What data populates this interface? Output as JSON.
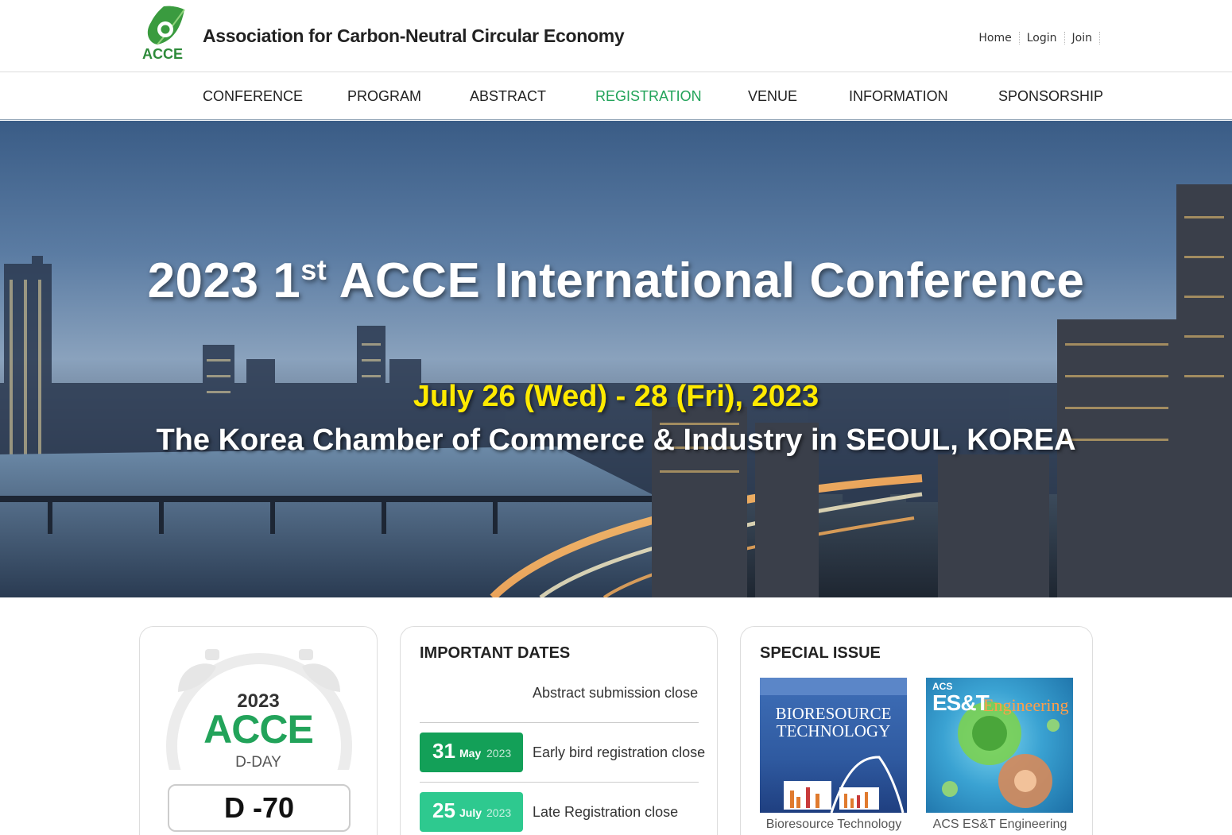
{
  "header": {
    "logo_text": "ACCE",
    "site_title": "Association for Carbon-Neutral Circular Economy",
    "util_links": [
      "Home",
      "Login",
      "Join"
    ]
  },
  "nav": {
    "items": [
      "CONFERENCE",
      "PROGRAM",
      "ABSTRACT",
      "REGISTRATION",
      "VENUE",
      "INFORMATION",
      "SPONSORSHIP"
    ],
    "active": "REGISTRATION",
    "active_color": "#22a35a"
  },
  "hero": {
    "title_prefix": "2023 1",
    "title_sup": "st",
    "title_suffix": " ACCE International Conference",
    "date": "July 26 (Wed) - 28 (Fri), 2023",
    "venue": "The Korea Chamber of Commerce & Industry in SEOUL, KOREA",
    "date_color": "#ffea00"
  },
  "dday": {
    "year": "2023",
    "name": "ACCE",
    "label": "D-DAY",
    "countdown": "D -70",
    "accent": "#22a35a"
  },
  "important_dates": {
    "heading": "IMPORTANT DATES",
    "items": [
      {
        "day": "",
        "month": "",
        "year": "",
        "label": "Abstract submission close"
      },
      {
        "day": "31",
        "month": "May",
        "year": "2023",
        "label": "Early bird registration close",
        "color": "#13a058"
      },
      {
        "day": "25",
        "month": "July",
        "year": "2023",
        "label": "Late Registration close",
        "color": "#2ec98f"
      }
    ]
  },
  "special_issue": {
    "heading": "SPECIAL ISSUE",
    "journals": [
      {
        "name": "Bioresource Technology",
        "cover_title_1": "BIORESOURCE",
        "cover_title_2": "TECHNOLOGY"
      },
      {
        "name": "ACS ES&T Engineering",
        "cover_title_1": "ACS",
        "cover_title_2": "ES&T",
        "cover_title_3": "Engineering"
      }
    ]
  }
}
